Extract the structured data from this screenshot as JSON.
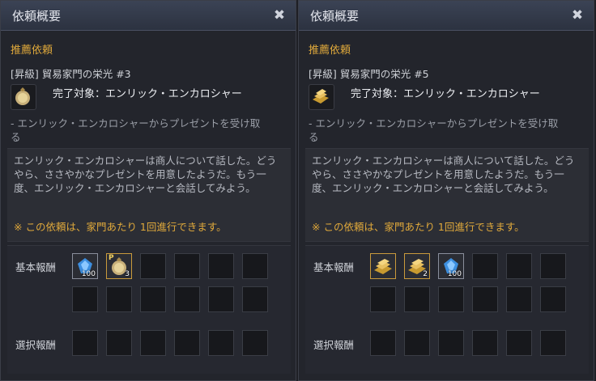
{
  "panels": [
    {
      "title": "依頼概要",
      "section_label": "推薦依頼",
      "quest_name": "[昇級] 貿易家門の栄光 #3",
      "quest_icon": "coin-pouch-icon",
      "target": "完了対象：エンリック・エンカロシャー",
      "sub_text": "- エンリック・エンカロシャーからプレゼントを受け取る",
      "description": "エンリック・エンカロシャーは商人について話した。どうやら、ささやかなプレゼントを用意したようだ。もう一度、エンリック・エンカロシャーと会話してみよう。",
      "note": "※ この依頼は、家門あたり 1回進行できます。",
      "basic_reward_label": "基本報酬",
      "select_reward_label": "選択報酬",
      "rewards": [
        {
          "icon": "blue-crystal-icon",
          "qty": "100"
        },
        {
          "icon": "coin-pouch-icon",
          "qty": "3",
          "badge": "P"
        }
      ]
    },
    {
      "title": "依頼概要",
      "section_label": "推薦依頼",
      "quest_name": "[昇級] 貿易家門の栄光 #5",
      "quest_icon": "gold-bars-icon",
      "target": "完了対象：エンリック・エンカロシャー",
      "sub_text": "- エンリック・エンカロシャーからプレゼントを受け取る",
      "description": "エンリック・エンカロシャーは商人について話した。どうやら、ささやかなプレゼントを用意したようだ。もう一度、エンリック・エンカロシャーと会話してみよう。",
      "note": "※ この依頼は、家門あたり 1回進行できます。",
      "basic_reward_label": "基本報酬",
      "select_reward_label": "選択報酬",
      "rewards": [
        {
          "icon": "gold-bars-icon",
          "qty": ""
        },
        {
          "icon": "gold-bars-icon",
          "qty": "2"
        },
        {
          "icon": "blue-crystal-icon",
          "qty": "100"
        }
      ]
    }
  ],
  "colors": {
    "accent": "#e0a93b",
    "gold_border": "#c99a3c",
    "crystal": "#3d8fe0"
  }
}
